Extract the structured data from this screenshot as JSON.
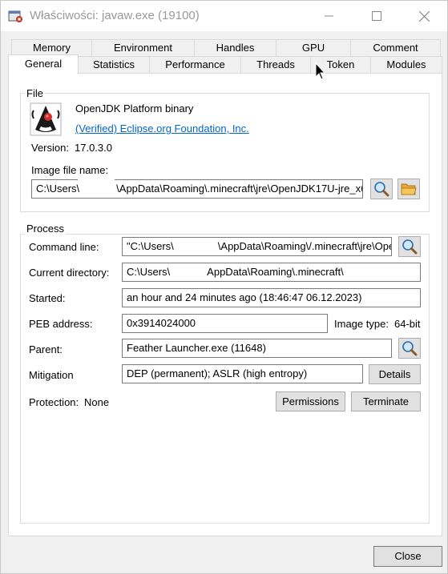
{
  "window": {
    "title": "Właściwości: javaw.exe (19100)"
  },
  "tabs_top": [
    "Memory",
    "Environment",
    "Handles",
    "GPU",
    "Comment"
  ],
  "tabs_bottom": [
    "General",
    "Statistics",
    "Performance",
    "Threads",
    "Token",
    "Modules"
  ],
  "active_tab": "General",
  "file": {
    "group_label": "File",
    "description": "OpenJDK Platform binary",
    "verified": "(Verified) Eclipse.org Foundation, Inc.",
    "version_label": "Version:",
    "version_value": "17.0.3.0",
    "image_label": "Image file name:",
    "image_value_a": "C:\\Users\\",
    "image_value_b": "\\AppData\\Roaming\\.minecraft\\jre\\OpenJDK17U-jre_x6"
  },
  "process": {
    "group_label": "Process",
    "cmd_label": "Command line:",
    "cmd_value_a": "\"C:\\Users\\",
    "cmd_value_b": "\\AppData\\Roaming\\/.minecraft\\jre\\Open",
    "dir_label": "Current directory:",
    "dir_value_a": "C:\\Users\\",
    "dir_value_b": "AppData\\Roaming\\.minecraft\\",
    "started_label": "Started:",
    "started_value": "an hour and 24 minutes ago (18:46:47 06.12.2023)",
    "peb_label": "PEB address:",
    "peb_value": "0x3914024000",
    "image_type_label": "Image type:",
    "image_type_value": "64-bit",
    "parent_label": "Parent:",
    "parent_value": "Feather Launcher.exe (11648)",
    "mitigation_label": "Mitigation",
    "mitigation_value": "DEP (permanent); ASLR (high entropy)",
    "details_button": "Details",
    "protection_label": "Protection:",
    "protection_value": "None",
    "permissions_button": "Permissions",
    "terminate_button": "Terminate"
  },
  "footer": {
    "close_button": "Close"
  },
  "icons": {
    "app": "process-icon",
    "java": "java-duke-icon",
    "search": "magnifier-icon",
    "folder": "folder-icon"
  }
}
